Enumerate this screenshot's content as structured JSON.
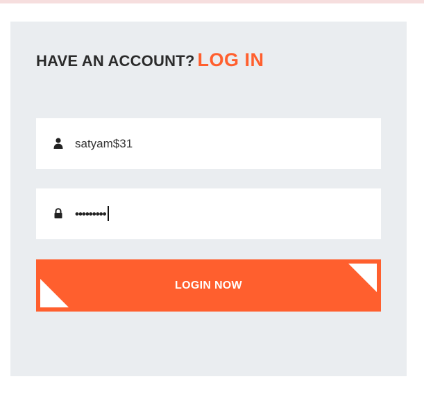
{
  "login": {
    "heading_prefix": "HAVE AN ACCOUNT?",
    "heading_accent": "LOG IN",
    "username": {
      "icon": "user-icon",
      "value": "satyam$31"
    },
    "password": {
      "icon": "lock-icon",
      "masked_value": "•••••••••"
    },
    "submit_label": "LOGIN NOW"
  },
  "colors": {
    "accent": "#ff5f2e",
    "panel_background": "#eaedf0",
    "field_background": "#ffffff",
    "heading_text": "#2b2b2b"
  }
}
